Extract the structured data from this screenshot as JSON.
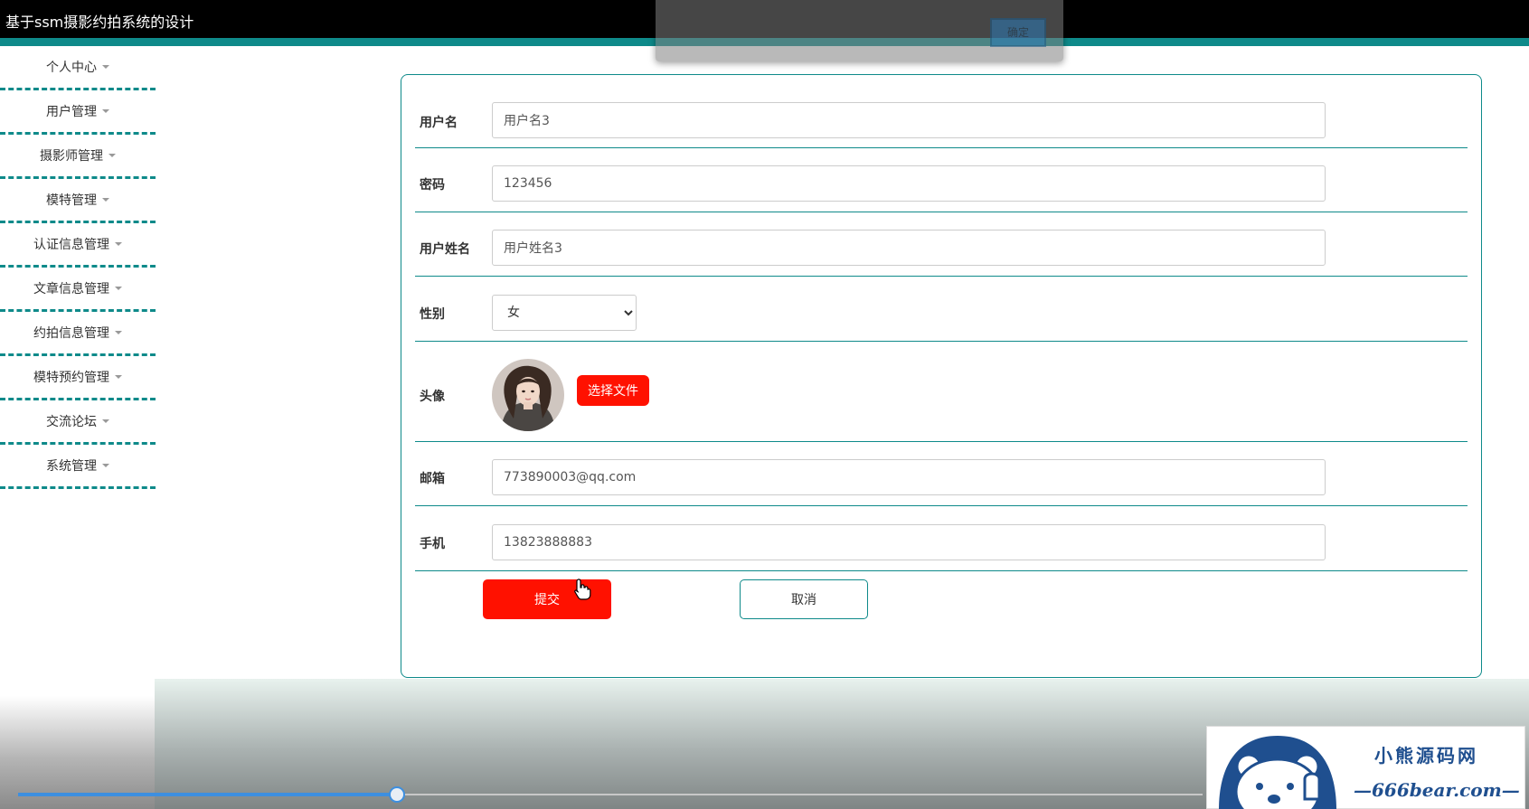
{
  "header": {
    "title": "基于ssm摄影约拍系统的设计"
  },
  "alert": {
    "ok_label": "确定"
  },
  "sidebar": {
    "items": [
      {
        "label": "个人中心"
      },
      {
        "label": "用户管理"
      },
      {
        "label": "摄影师管理"
      },
      {
        "label": "模特管理"
      },
      {
        "label": "认证信息管理"
      },
      {
        "label": "文章信息管理"
      },
      {
        "label": "约拍信息管理"
      },
      {
        "label": "模特预约管理"
      },
      {
        "label": "交流论坛"
      },
      {
        "label": "系统管理"
      }
    ]
  },
  "form": {
    "username": {
      "label": "用户名",
      "value": "用户名3"
    },
    "password": {
      "label": "密码",
      "value": "123456"
    },
    "realname": {
      "label": "用户姓名",
      "value": "用户姓名3"
    },
    "gender": {
      "label": "性别",
      "selected": "女"
    },
    "avatar": {
      "label": "头像",
      "button": "选择文件"
    },
    "email": {
      "label": "邮箱",
      "value": "773890003@qq.com"
    },
    "phone": {
      "label": "手机",
      "value": "13823888883"
    },
    "submit_label": "提交",
    "cancel_label": "取消"
  },
  "player": {
    "progress_fraction": 0.32
  },
  "watermark": {
    "brand": "小熊源码网",
    "domain": "—666bear.com—"
  },
  "colors": {
    "accent": "#0e8a8a",
    "primary_button": "#ff1100",
    "header_bg": "#000000"
  }
}
